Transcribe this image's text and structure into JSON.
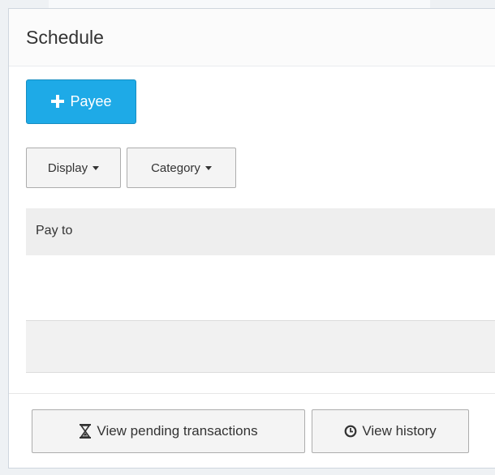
{
  "panel": {
    "title": "Schedule"
  },
  "toolbar": {
    "add_payee_label": "Payee",
    "display_label": "Display",
    "category_label": "Category"
  },
  "table": {
    "columns": [
      "Pay to"
    ],
    "rows": []
  },
  "footer": {
    "pending_label": "View pending transactions",
    "history_label": "View history"
  },
  "icons": {
    "add": "plus-icon",
    "dropdown": "caret-down-icon",
    "pending": "hourglass-icon",
    "history": "clock-icon"
  },
  "colors": {
    "primary_button": "#1eaae7",
    "panel_background": "#ffffff",
    "page_background": "#eef1f4"
  }
}
